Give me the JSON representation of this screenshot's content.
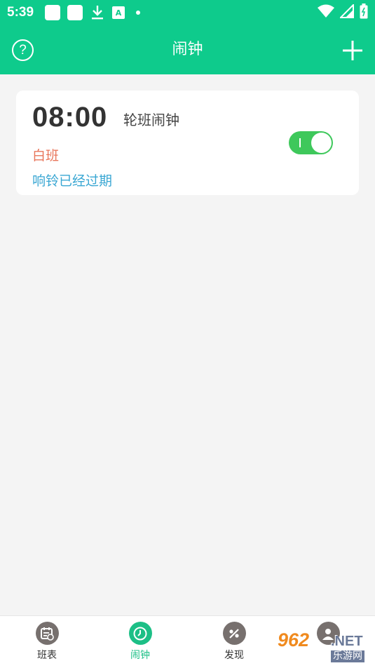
{
  "status_bar": {
    "time": "5:39",
    "icons": [
      "notification-square-icon",
      "notification-square-icon",
      "download-icon",
      "translate-a-icon",
      "dot-icon",
      "wifi-icon",
      "signal-icon",
      "battery-icon"
    ],
    "a_glyph": "A"
  },
  "header": {
    "title": "闹钟",
    "help_glyph": "?",
    "left_icon": "help-circle-icon",
    "right_icon": "plus-icon"
  },
  "alarm": {
    "time": "08:00",
    "name": "轮班闹钟",
    "shift": "白班",
    "status": "响铃已经过期",
    "enabled": true
  },
  "bottom_nav": {
    "items": [
      {
        "label": "班表",
        "icon": "calendar-icon",
        "active": false
      },
      {
        "label": "闹钟",
        "icon": "clock-icon",
        "active": true
      },
      {
        "label": "发现",
        "icon": "discover-icon",
        "active": false
      },
      {
        "label": "",
        "icon": "user-icon",
        "active": false
      }
    ]
  },
  "watermark": {
    "number": "962",
    "suffix": ".NET",
    "site": "乐游网"
  },
  "colors": {
    "brand_green": "#0ecb8c",
    "background": "#f4f4f4",
    "shift_orange": "#e8765b",
    "status_blue": "#3aa7d3",
    "toggle_green": "#3ec85b",
    "nav_active": "#1cbf86",
    "nav_inactive_icon": "#77706e"
  }
}
